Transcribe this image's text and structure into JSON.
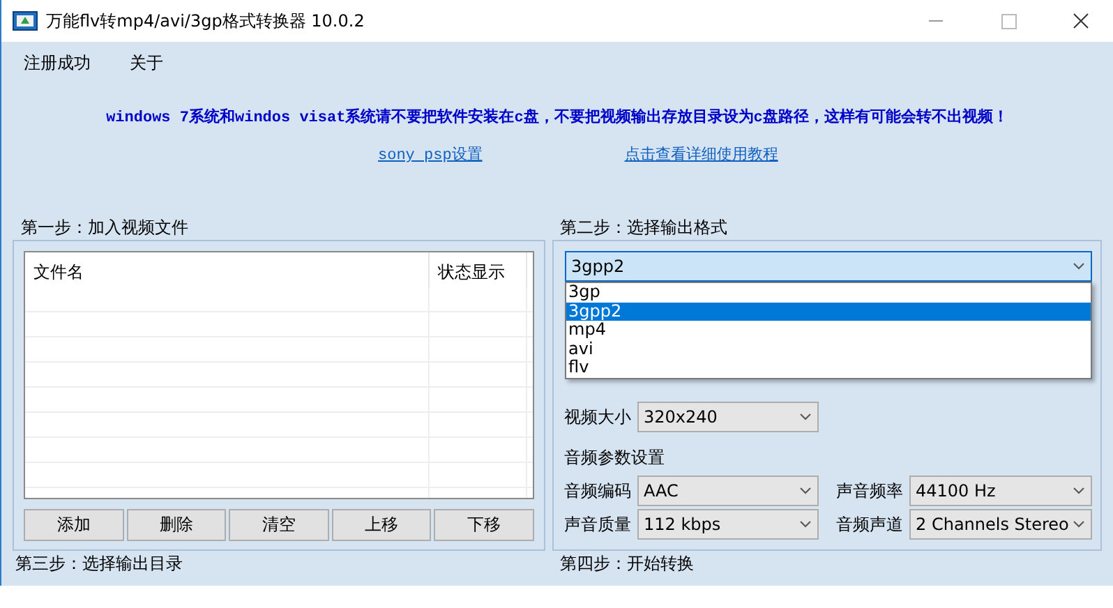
{
  "window": {
    "title": "万能flv转mp4/avi/3gp格式转换器 10.0.2"
  },
  "menu": [
    {
      "label": "注册成功"
    },
    {
      "label": "关于"
    }
  ],
  "notice": "windows 7系统和windos visat系统请不要把软件安装在c盘，不要把视频输出存放目录设为c盘路径，这样有可能会转不出视频！",
  "links": [
    {
      "label": "sony psp设置"
    },
    {
      "label": "点击查看详细使用教程"
    }
  ],
  "step1": {
    "label": "第一步：加入视频文件",
    "columns": [
      "文件名",
      "状态显示"
    ],
    "buttons": [
      "添加",
      "删除",
      "清空",
      "上移",
      "下移"
    ]
  },
  "step2": {
    "label": "第二步：选择输出格式",
    "format": {
      "value": "3gpp2",
      "expanded": true,
      "options": [
        {
          "label": "3gp",
          "selected": false
        },
        {
          "label": "3gpp2",
          "selected": true
        },
        {
          "label": "mp4",
          "selected": false
        },
        {
          "label": "avi",
          "selected": false
        },
        {
          "label": "flv",
          "selected": false
        }
      ]
    },
    "video_rows": [
      [
        {
          "label": "视频大小",
          "value": "320x240"
        }
      ]
    ],
    "audio_heading": "音频参数设置",
    "audio_rows": [
      [
        {
          "label": "音频编码",
          "value": "AAC"
        },
        {
          "label": "声音频率",
          "value": "44100 Hz"
        }
      ],
      [
        {
          "label": "声音质量",
          "value": "112 kbps"
        },
        {
          "label": "音频声道",
          "value": "2 Channels Stereo"
        }
      ]
    ]
  },
  "step3": {
    "label": "第三步：选择输出目录"
  },
  "step4": {
    "label": "第四步：开始转换"
  }
}
